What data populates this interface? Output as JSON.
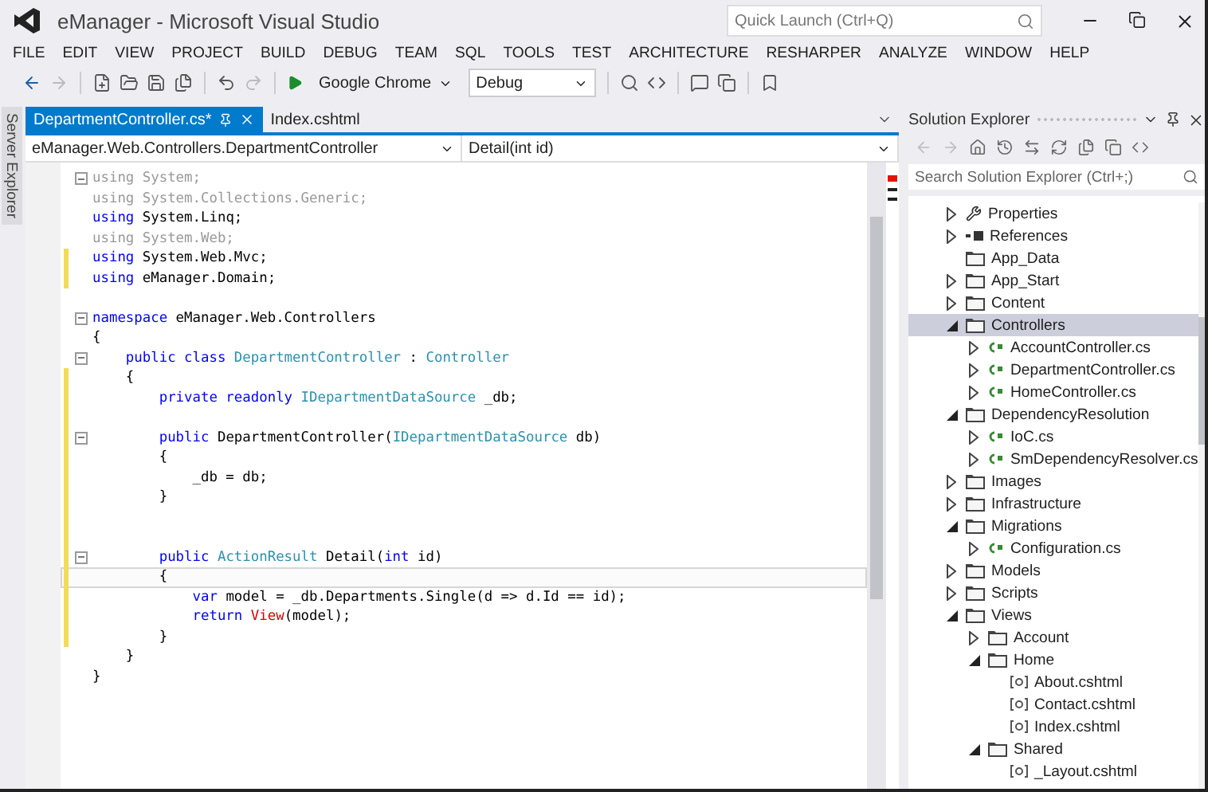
{
  "window": {
    "title": "eManager - Microsoft Visual Studio"
  },
  "quick_launch": {
    "placeholder": "Quick Launch (Ctrl+Q)"
  },
  "menu": [
    "FILE",
    "EDIT",
    "VIEW",
    "PROJECT",
    "BUILD",
    "DEBUG",
    "TEAM",
    "SQL",
    "TOOLS",
    "TEST",
    "ARCHITECTURE",
    "RESHARPER",
    "ANALYZE",
    "WINDOW",
    "HELP"
  ],
  "toolbar": {
    "browser": "Google Chrome",
    "configuration": "Debug"
  },
  "side_strip": {
    "label": "Server Explorer"
  },
  "editor": {
    "tabs": [
      {
        "label": "DepartmentController.cs*",
        "selected": true
      },
      {
        "label": "Index.cshtml",
        "selected": false
      }
    ],
    "nav": {
      "type": "eManager.Web.Controllers.DepartmentController",
      "member": "Detail(int id)"
    },
    "lines": [
      {
        "fold": true,
        "changed": false,
        "current": false,
        "tokens": [
          {
            "kind": "faded",
            "text": "using System;"
          }
        ]
      },
      {
        "fold": false,
        "changed": false,
        "current": false,
        "tokens": [
          {
            "kind": "faded",
            "text": "using System.Collections.Generic;"
          }
        ]
      },
      {
        "fold": false,
        "changed": false,
        "current": false,
        "tokens": [
          {
            "kind": "keyword",
            "text": "using"
          },
          {
            "kind": "plain",
            "text": " System.Linq;"
          }
        ]
      },
      {
        "fold": false,
        "changed": false,
        "current": false,
        "tokens": [
          {
            "kind": "faded",
            "text": "using System.Web;"
          }
        ]
      },
      {
        "fold": false,
        "changed": true,
        "current": false,
        "tokens": [
          {
            "kind": "keyword",
            "text": "using"
          },
          {
            "kind": "plain",
            "text": " System.Web.Mvc;"
          }
        ]
      },
      {
        "fold": false,
        "changed": true,
        "current": false,
        "tokens": [
          {
            "kind": "keyword",
            "text": "using"
          },
          {
            "kind": "plain",
            "text": " eManager.Domain;"
          }
        ]
      },
      {
        "fold": false,
        "changed": false,
        "current": false
      },
      {
        "fold": true,
        "changed": false,
        "current": false,
        "tokens": [
          {
            "kind": "keyword",
            "text": "namespace"
          },
          {
            "kind": "plain",
            "text": " eManager.Web.Controllers"
          }
        ]
      },
      {
        "fold": false,
        "changed": false,
        "current": false,
        "tokens": [
          {
            "kind": "plain",
            "text": "{"
          }
        ]
      },
      {
        "fold": true,
        "changed": false,
        "current": false,
        "tokens": [
          {
            "kind": "keyword",
            "text": "    public class "
          },
          {
            "kind": "type",
            "text": "DepartmentController"
          },
          {
            "kind": "plain",
            "text": " : "
          },
          {
            "kind": "type",
            "text": "Controller"
          }
        ]
      },
      {
        "fold": false,
        "changed": true,
        "current": false,
        "tokens": [
          {
            "kind": "plain",
            "text": "    {"
          }
        ]
      },
      {
        "fold": false,
        "changed": true,
        "current": false,
        "tokens": [
          {
            "kind": "keyword",
            "text": "        private readonly "
          },
          {
            "kind": "type",
            "text": "IDepartmentDataSource"
          },
          {
            "kind": "plain",
            "text": " _db;"
          }
        ]
      },
      {
        "fold": false,
        "changed": true,
        "current": false
      },
      {
        "fold": true,
        "changed": true,
        "current": false,
        "tokens": [
          {
            "kind": "keyword",
            "text": "        public"
          },
          {
            "kind": "plain",
            "text": " DepartmentController("
          },
          {
            "kind": "type",
            "text": "IDepartmentDataSource"
          },
          {
            "kind": "plain",
            "text": " db)"
          }
        ]
      },
      {
        "fold": false,
        "changed": true,
        "current": false,
        "tokens": [
          {
            "kind": "plain",
            "text": "        {"
          }
        ]
      },
      {
        "fold": false,
        "changed": true,
        "current": false,
        "tokens": [
          {
            "kind": "plain",
            "text": "            _db = db;"
          }
        ]
      },
      {
        "fold": false,
        "changed": true,
        "current": false,
        "tokens": [
          {
            "kind": "plain",
            "text": "        }"
          }
        ]
      },
      {
        "fold": false,
        "changed": true,
        "current": false
      },
      {
        "fold": false,
        "changed": true,
        "current": false
      },
      {
        "fold": true,
        "changed": true,
        "current": false,
        "tokens": [
          {
            "kind": "keyword",
            "text": "        public "
          },
          {
            "kind": "type",
            "text": "ActionResult"
          },
          {
            "kind": "plain",
            "text": " Detail("
          },
          {
            "kind": "keyword",
            "text": "int"
          },
          {
            "kind": "plain",
            "text": " id)"
          }
        ]
      },
      {
        "fold": false,
        "changed": true,
        "current": true,
        "tokens": [
          {
            "kind": "plain",
            "text": "        {"
          }
        ]
      },
      {
        "fold": false,
        "changed": true,
        "current": false,
        "tokens": [
          {
            "kind": "keyword",
            "text": "            var"
          },
          {
            "kind": "plain",
            "text": " model = _db.Departments.Single(d => d.Id == id);"
          }
        ]
      },
      {
        "fold": false,
        "changed": true,
        "current": false,
        "tokens": [
          {
            "kind": "keyword",
            "text": "            return "
          },
          {
            "kind": "method",
            "text": "View"
          },
          {
            "kind": "plain",
            "text": "(model);"
          }
        ]
      },
      {
        "fold": false,
        "changed": true,
        "current": false,
        "tokens": [
          {
            "kind": "plain",
            "text": "        }"
          }
        ]
      },
      {
        "fold": false,
        "changed": false,
        "current": false,
        "tokens": [
          {
            "kind": "plain",
            "text": "    }"
          }
        ]
      },
      {
        "fold": false,
        "changed": false,
        "current": false,
        "tokens": [
          {
            "kind": "plain",
            "text": "}"
          }
        ]
      }
    ]
  },
  "solution_explorer": {
    "title": "Solution Explorer",
    "search": {
      "placeholder": "Search Solution Explorer (Ctrl+;)"
    },
    "items": [
      {
        "label": "Properties",
        "kind": "wrench",
        "expandable": true,
        "expanded": false,
        "selected": false
      },
      {
        "label": "References",
        "kind": "references",
        "expandable": true,
        "expanded": false,
        "selected": false
      },
      {
        "label": "App_Data",
        "kind": "folder",
        "expandable": false,
        "selected": false
      },
      {
        "label": "App_Start",
        "kind": "folder",
        "expandable": true,
        "expanded": false,
        "selected": false
      },
      {
        "label": "Content",
        "kind": "folder",
        "expandable": true,
        "expanded": false,
        "selected": false
      },
      {
        "label": "Controllers",
        "kind": "folder",
        "expandable": true,
        "expanded": true,
        "selected": true,
        "children": [
          {
            "label": "AccountController.cs",
            "kind": "cs",
            "expandable": true,
            "expanded": false,
            "selected": false
          },
          {
            "label": "DepartmentController.cs",
            "kind": "cs",
            "expandable": true,
            "expanded": false,
            "selected": false
          },
          {
            "label": "HomeController.cs",
            "kind": "cs",
            "expandable": true,
            "expanded": false,
            "selected": false
          }
        ]
      },
      {
        "label": "DependencyResolution",
        "kind": "folder",
        "expandable": true,
        "expanded": true,
        "selected": false,
        "children": [
          {
            "label": "IoC.cs",
            "kind": "cs",
            "expandable": true,
            "expanded": false,
            "selected": false
          },
          {
            "label": "SmDependencyResolver.cs",
            "kind": "cs",
            "expandable": true,
            "expanded": false,
            "selected": false
          }
        ]
      },
      {
        "label": "Images",
        "kind": "folder",
        "expandable": true,
        "expanded": false,
        "selected": false
      },
      {
        "label": "Infrastructure",
        "kind": "folder",
        "expandable": true,
        "expanded": false,
        "selected": false
      },
      {
        "label": "Migrations",
        "kind": "folder",
        "expandable": true,
        "expanded": true,
        "selected": false,
        "children": [
          {
            "label": "Configuration.cs",
            "kind": "cs",
            "expandable": true,
            "expanded": false,
            "selected": false
          }
        ]
      },
      {
        "label": "Models",
        "kind": "folder",
        "expandable": true,
        "expanded": false,
        "selected": false
      },
      {
        "label": "Scripts",
        "kind": "folder",
        "expandable": true,
        "expanded": false,
        "selected": false
      },
      {
        "label": "Views",
        "kind": "folder",
        "expandable": true,
        "expanded": true,
        "selected": false,
        "children": [
          {
            "label": "Account",
            "kind": "folder",
            "expandable": true,
            "expanded": false,
            "selected": false
          },
          {
            "label": "Home",
            "kind": "folder",
            "expandable": true,
            "expanded": true,
            "selected": false,
            "children": [
              {
                "label": "About.cshtml",
                "kind": "cshtml",
                "expandable": false,
                "selected": false
              },
              {
                "label": "Contact.cshtml",
                "kind": "cshtml",
                "expandable": false,
                "selected": false
              },
              {
                "label": "Index.cshtml",
                "kind": "cshtml",
                "expandable": false,
                "selected": false
              }
            ]
          },
          {
            "label": "Shared",
            "kind": "folder",
            "expandable": true,
            "expanded": true,
            "selected": false,
            "children": [
              {
                "label": "_Layout.cshtml",
                "kind": "cshtml",
                "expandable": false,
                "selected": false
              }
            ]
          }
        ]
      }
    ]
  }
}
